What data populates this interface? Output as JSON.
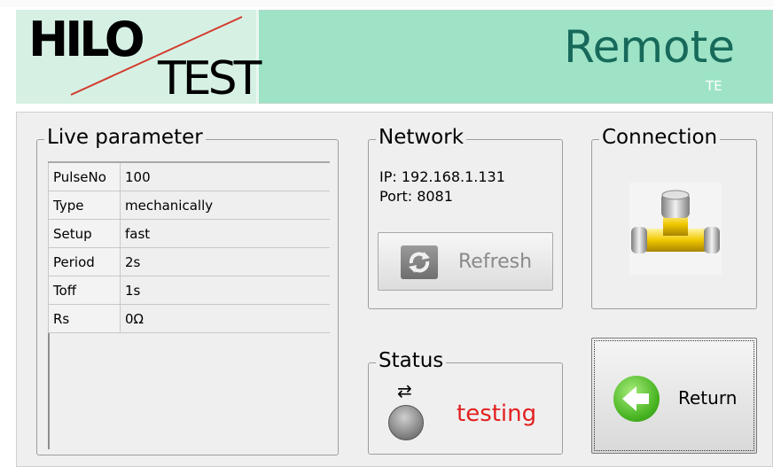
{
  "header": {
    "logo_top": "HILO",
    "logo_bottom": "TEST",
    "title": "Remote",
    "subtitle": "TE"
  },
  "live": {
    "legend": "Live parameter",
    "rows": [
      {
        "key": "PulseNo",
        "value": "100"
      },
      {
        "key": "Type",
        "value": "mechanically"
      },
      {
        "key": "Setup",
        "value": "fast"
      },
      {
        "key": "Period",
        "value": "2s"
      },
      {
        "key": "Toff",
        "value": "1s"
      },
      {
        "key": "Rs",
        "value": "0Ω"
      }
    ]
  },
  "network": {
    "legend": "Network",
    "ip": "IP: 192.168.1.131",
    "port": "Port: 8081",
    "refresh_label": "Refresh",
    "refresh_icon": "refresh-icon"
  },
  "connection": {
    "legend": "Connection",
    "icon": "pipe-connector-icon"
  },
  "status": {
    "legend": "Status",
    "arrows": "⇄",
    "text": "testing",
    "text_color": "#e31f1f"
  },
  "return_button": {
    "label": "Return",
    "icon": "back-arrow-icon"
  },
  "colors": {
    "header_bg": "#9ee3c6",
    "title": "#17695a",
    "panel_bg": "#efefef"
  }
}
